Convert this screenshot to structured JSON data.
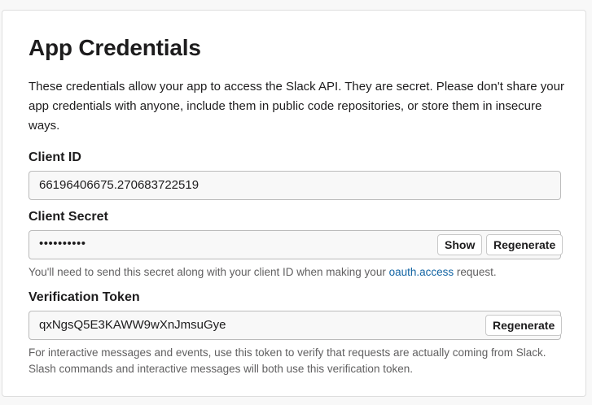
{
  "title": "App Credentials",
  "intro": "These credentials allow your app to access the Slack API. They are secret. Please don't share your app credentials with anyone, include them in public code repositories, or store them in insecure ways.",
  "client_id": {
    "label": "Client ID",
    "value": "66196406675.270683722519"
  },
  "client_secret": {
    "label": "Client Secret",
    "value_masked": "••••••••••",
    "show_label": "Show",
    "regenerate_label": "Regenerate",
    "hint_before": "You'll need to send this secret along with your client ID when making your ",
    "hint_link": "oauth.access",
    "hint_after": " request."
  },
  "verification_token": {
    "label": "Verification Token",
    "value": "qxNgsQ5E3KAWW9wXnJmsuGye",
    "regenerate_label": "Regenerate",
    "hint": "For interactive messages and events, use this token to verify that requests are actually coming from Slack. Slash commands and interactive messages will both use this verification token."
  },
  "colors": {
    "link": "#1264a3",
    "text": "#1d1c1d",
    "hint": "#616061"
  }
}
